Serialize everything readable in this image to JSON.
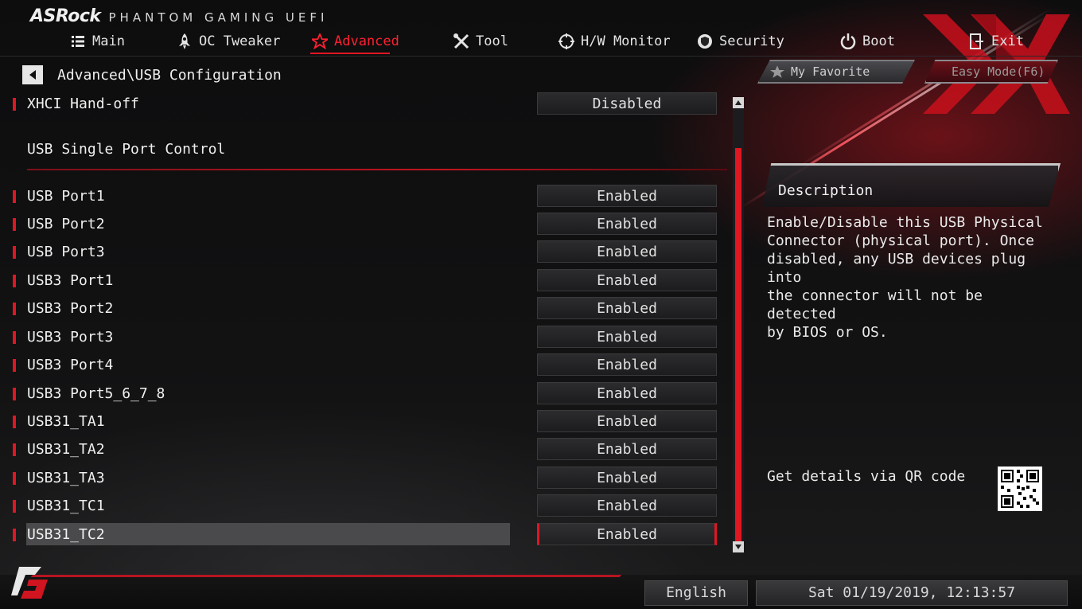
{
  "header": {
    "brand": "ASRock",
    "subtitle": "PHANTOM GAMING UEFI"
  },
  "nav": {
    "items": [
      {
        "label": "Main",
        "icon": "list-icon"
      },
      {
        "label": "OC Tweaker",
        "icon": "rocket-icon"
      },
      {
        "label": "Advanced",
        "icon": "star-icon",
        "active": true
      },
      {
        "label": "Tool",
        "icon": "tools-icon"
      },
      {
        "label": "H/W Monitor",
        "icon": "monitor-icon"
      },
      {
        "label": "Security",
        "icon": "shield-icon"
      },
      {
        "label": "Boot",
        "icon": "power-icon"
      },
      {
        "label": "Exit",
        "icon": "exit-icon"
      }
    ]
  },
  "breadcrumb": "Advanced\\USB Configuration",
  "favorite": {
    "label": "My Favorite"
  },
  "easy_mode": {
    "label": "Easy Mode(F6)"
  },
  "settings": {
    "xhci": {
      "label": "XHCI Hand-off",
      "value": "Disabled"
    },
    "section_title": "USB Single Port Control",
    "rows": [
      {
        "label": "USB Port1",
        "value": "Enabled"
      },
      {
        "label": "USB Port2",
        "value": "Enabled"
      },
      {
        "label": "USB Port3",
        "value": "Enabled"
      },
      {
        "label": "USB3 Port1",
        "value": "Enabled"
      },
      {
        "label": "USB3 Port2",
        "value": "Enabled"
      },
      {
        "label": "USB3 Port3",
        "value": "Enabled"
      },
      {
        "label": "USB3 Port4",
        "value": "Enabled"
      },
      {
        "label": "USB3 Port5_6_7_8",
        "value": "Enabled"
      },
      {
        "label": "USB31_TA1",
        "value": "Enabled"
      },
      {
        "label": "USB31_TA2",
        "value": "Enabled"
      },
      {
        "label": "USB31_TA3",
        "value": "Enabled"
      },
      {
        "label": "USB31_TC1",
        "value": "Enabled"
      },
      {
        "label": "USB31_TC2",
        "value": "Enabled",
        "selected": true
      }
    ]
  },
  "description": {
    "title": "Description",
    "text": "Enable/Disable this USB Physical\nConnector (physical port).  Once\ndisabled, any USB devices plug into\nthe connector will not be detected\nby BIOS or OS.",
    "qr_text": "Get details via QR code"
  },
  "footer": {
    "language": "English",
    "datetime": "Sat 01/19/2019, 12:13:57"
  },
  "colors": {
    "accent": "#e01622",
    "background": "#0b0b0c",
    "text": "#f0f0f0"
  }
}
